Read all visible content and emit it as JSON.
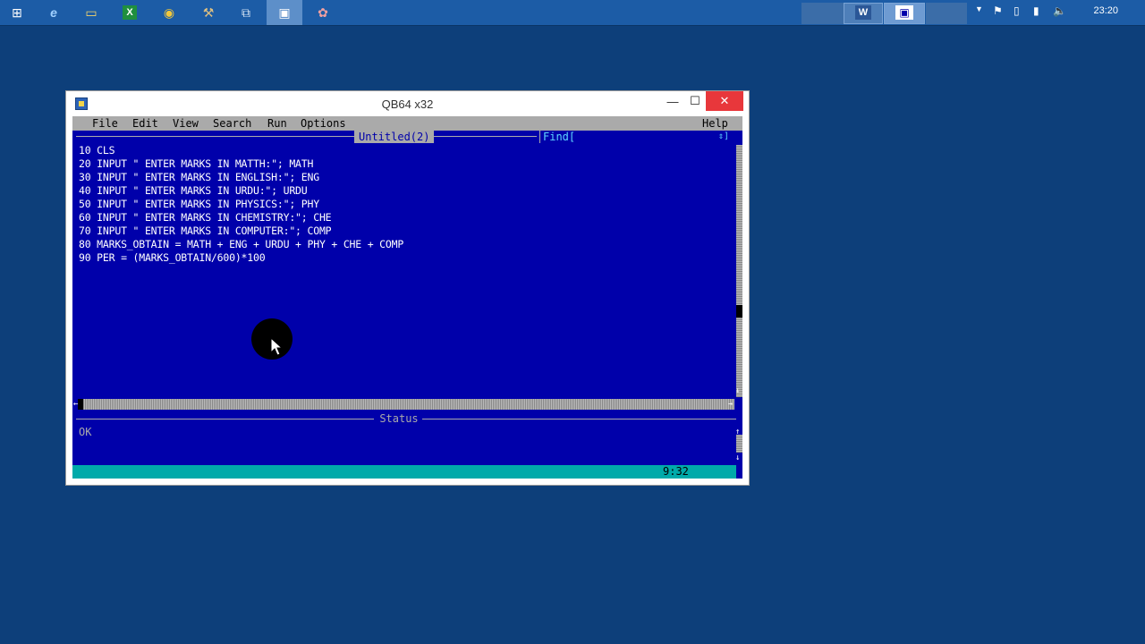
{
  "taskbar": {
    "icons": [
      {
        "name": "start-icon",
        "glyph": "⊞"
      },
      {
        "name": "internet-explorer-icon",
        "glyph": "e"
      },
      {
        "name": "file-explorer-icon",
        "glyph": "▭"
      },
      {
        "name": "excel-icon",
        "glyph": "X"
      },
      {
        "name": "chrome-icon",
        "glyph": "◉"
      },
      {
        "name": "tools-icon",
        "glyph": "⚒"
      },
      {
        "name": "remote-desktop-icon",
        "glyph": "⧉"
      },
      {
        "name": "qb64-taskbar-icon",
        "glyph": "▣"
      },
      {
        "name": "paint-icon",
        "glyph": "✿"
      }
    ],
    "tray_apps": [
      {
        "name": "word-tray-icon",
        "glyph": "W"
      },
      {
        "name": "qb64-tray-icon",
        "glyph": "▣"
      }
    ],
    "clock": "23:20"
  },
  "window": {
    "title": "QB64 x32",
    "controls": {
      "minimize": "—",
      "maximize": "☐",
      "close": "✕"
    }
  },
  "menu": {
    "items": [
      "File",
      "Edit",
      "View",
      "Search",
      "Run",
      "Options"
    ],
    "help": "Help"
  },
  "editor": {
    "tab_title": "Untitled(2)",
    "find_label": "Find[",
    "find_arrows": "⇕]",
    "code_lines": [
      "10 CLS",
      "20 INPUT \" ENTER MARKS IN MATTH:\"; MATH",
      "30 INPUT \" ENTER MARKS IN ENGLISH:\"; ENG",
      "40 INPUT \" ENTER MARKS IN URDU:\"; URDU",
      "50 INPUT \" ENTER MARKS IN PHYSICS:\"; PHY",
      "60 INPUT \" ENTER MARKS IN CHEMISTRY:\"; CHE",
      "70 INPUT \" ENTER MARKS IN COMPUTER:\"; COMP",
      "80 MARKS_OBTAIN = MATH + ENG + URDU + PHY + CHE + COMP",
      "90 PER = (MARKS_OBTAIN/600)*100"
    ]
  },
  "status": {
    "title": "Status",
    "message": "OK",
    "cursor_position": "9:32"
  },
  "colors": {
    "console_bg": "#0000aa",
    "menu_bg": "#aaaaaa",
    "status_bar_bg": "#00aaaa",
    "code_text": "#ffffff",
    "desktop_bg": "#0d3f7a"
  }
}
